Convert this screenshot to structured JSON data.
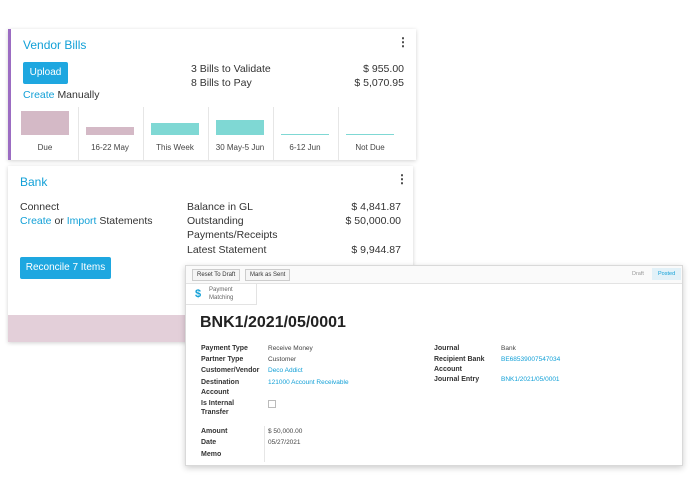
{
  "vendor_bills": {
    "title": "Vendor Bills",
    "upload_label": "Upload",
    "create_label": "Create",
    "manually_label": "Manually",
    "bills_to_validate": "3 Bills to Validate",
    "bills_to_validate_amount": "$ 955.00",
    "bills_to_pay": "8 Bills to Pay",
    "bills_to_pay_amount": "$ 5,070.95",
    "colors": {
      "past": "#d4b9c6",
      "future": "#7fd8d4",
      "accent": "#9b6cc2"
    }
  },
  "chart_data": {
    "type": "bar",
    "categories": [
      "Due",
      "16-22 May",
      "This Week",
      "30 May-5 Jun",
      "6-12 Jun",
      "Not Due"
    ],
    "values": [
      1.0,
      0.35,
      0.48,
      0.62,
      0.05,
      0.05
    ]
  },
  "bank": {
    "title": "Bank",
    "connect_label": "Connect",
    "create_label": "Create",
    "or_label": "or",
    "import_label": "Import",
    "statements_label": "Statements",
    "balance_label": "Balance in GL",
    "balance_amount": "$ 4,841.87",
    "outstanding_label": "Outstanding",
    "payments_receipts_label": "Payments/Receipts",
    "outstanding_amount": "$ 50,000.00",
    "latest_label": "Latest Statement",
    "latest_amount": "$ 9,944.87",
    "reconcile_label": "Reconcile 7 Items"
  },
  "form": {
    "reset_label": "Reset To Draft",
    "mark_sent_label": "Mark as Sent",
    "status_draft": "Draft",
    "status_posted": "Posted",
    "smart_button_icon": "dollar-icon",
    "smart_button_line1": "Payment",
    "smart_button_line2": "Matching",
    "record_title": "BNK1/2021/05/0001",
    "fields_left": [
      {
        "label": "Payment Type",
        "value": "Receive Money"
      },
      {
        "label": "Partner Type",
        "value": "Customer"
      },
      {
        "label": "Customer/Vendor",
        "value": "Deco Addict"
      },
      {
        "label": "Destination",
        "value": "121000 Account Receivable"
      },
      {
        "label": "Account",
        "value": ""
      },
      {
        "label": "Is Internal",
        "value": ""
      },
      {
        "label": "Transfer",
        "value": ""
      },
      {
        "label": "Amount",
        "value": "$ 50,000.00"
      },
      {
        "label": "Date",
        "value": "05/27/2021"
      },
      {
        "label": "Memo",
        "value": ""
      }
    ],
    "fields_right": [
      {
        "label": "Journal",
        "value": "Bank"
      },
      {
        "label": "Recipient Bank",
        "value": "BE68539007547034"
      },
      {
        "label": "Account",
        "value": ""
      },
      {
        "label": "Journal Entry",
        "value": "BNK1/2021/05/0001"
      }
    ]
  }
}
